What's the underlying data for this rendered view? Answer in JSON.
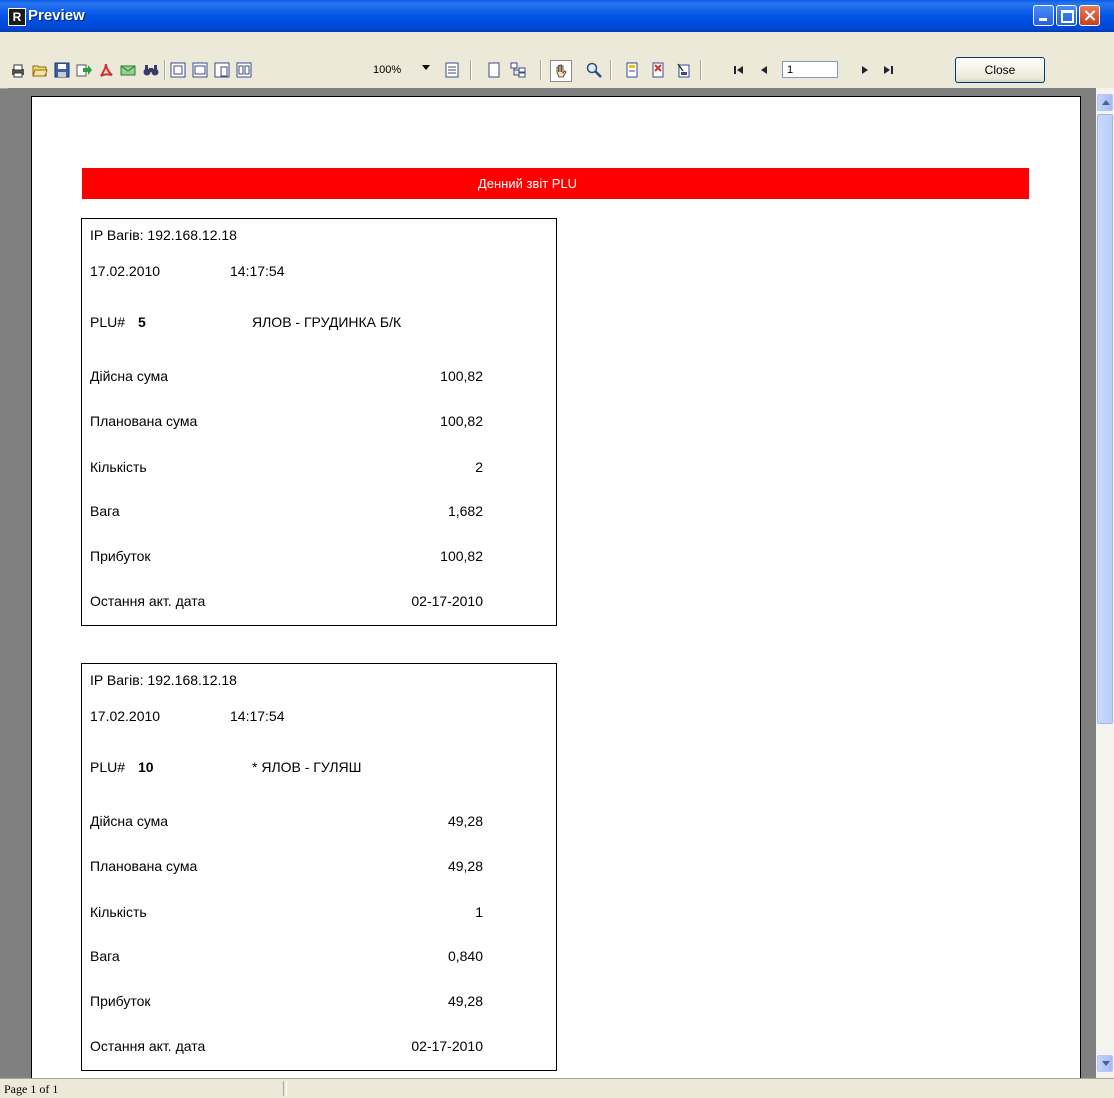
{
  "window": {
    "title": "Preview",
    "app_icon": "R"
  },
  "toolbar": {
    "icons": [
      "print-icon",
      "open-icon",
      "save-icon",
      "export-icon",
      "pdf-icon",
      "email-icon",
      "find-icon",
      "page-width-icon",
      "whole-page-icon",
      "one-page-icon",
      "two-pages-icon",
      "100%",
      "page-settings-icon",
      "outline-icon",
      "thumbnails-icon",
      "hand-tool-icon",
      "zoom-tool-icon",
      "edit-page-icon",
      "delete-page-icon",
      "page-design-icon",
      "first-page-icon",
      "prior-page-icon",
      "next-page-icon",
      "last-page-icon"
    ],
    "zoom_value": "100%",
    "page_number": "1",
    "close_label": "Close"
  },
  "report": {
    "title": "Денний звіт PLU",
    "cards": [
      {
        "ip_label": "IP Вагів: 192.168.12.18",
        "date": "17.02.2010",
        "time": "14:17:54",
        "plu_label": "PLU#",
        "plu_number": "5",
        "product_name": "ЯЛОВ - ГРУДИНКА Б/К",
        "rows": [
          {
            "label": "Дійсна сума",
            "value": "100,82"
          },
          {
            "label": "Планована сума",
            "value": "100,82"
          },
          {
            "label": "Кількість",
            "value": "2"
          },
          {
            "label": "Вага",
            "value": "1,682"
          },
          {
            "label": "Прибуток",
            "value": "100,82"
          },
          {
            "label": "Остання акт. дата",
            "value": "02-17-2010"
          }
        ]
      },
      {
        "ip_label": "IP Вагів: 192.168.12.18",
        "date": "17.02.2010",
        "time": "14:17:54",
        "plu_label": "PLU#",
        "plu_number": "10",
        "product_name": "* ЯЛОВ - ГУЛЯШ",
        "rows": [
          {
            "label": "Дійсна сума",
            "value": "49,28"
          },
          {
            "label": "Планована сума",
            "value": "49,28"
          },
          {
            "label": "Кількість",
            "value": "1"
          },
          {
            "label": "Вага",
            "value": "0,840"
          },
          {
            "label": "Прибуток",
            "value": "49,28"
          },
          {
            "label": "Остання акт. дата",
            "value": "02-17-2010"
          }
        ]
      }
    ]
  },
  "statusbar": {
    "text": "Page 1 of 1"
  }
}
